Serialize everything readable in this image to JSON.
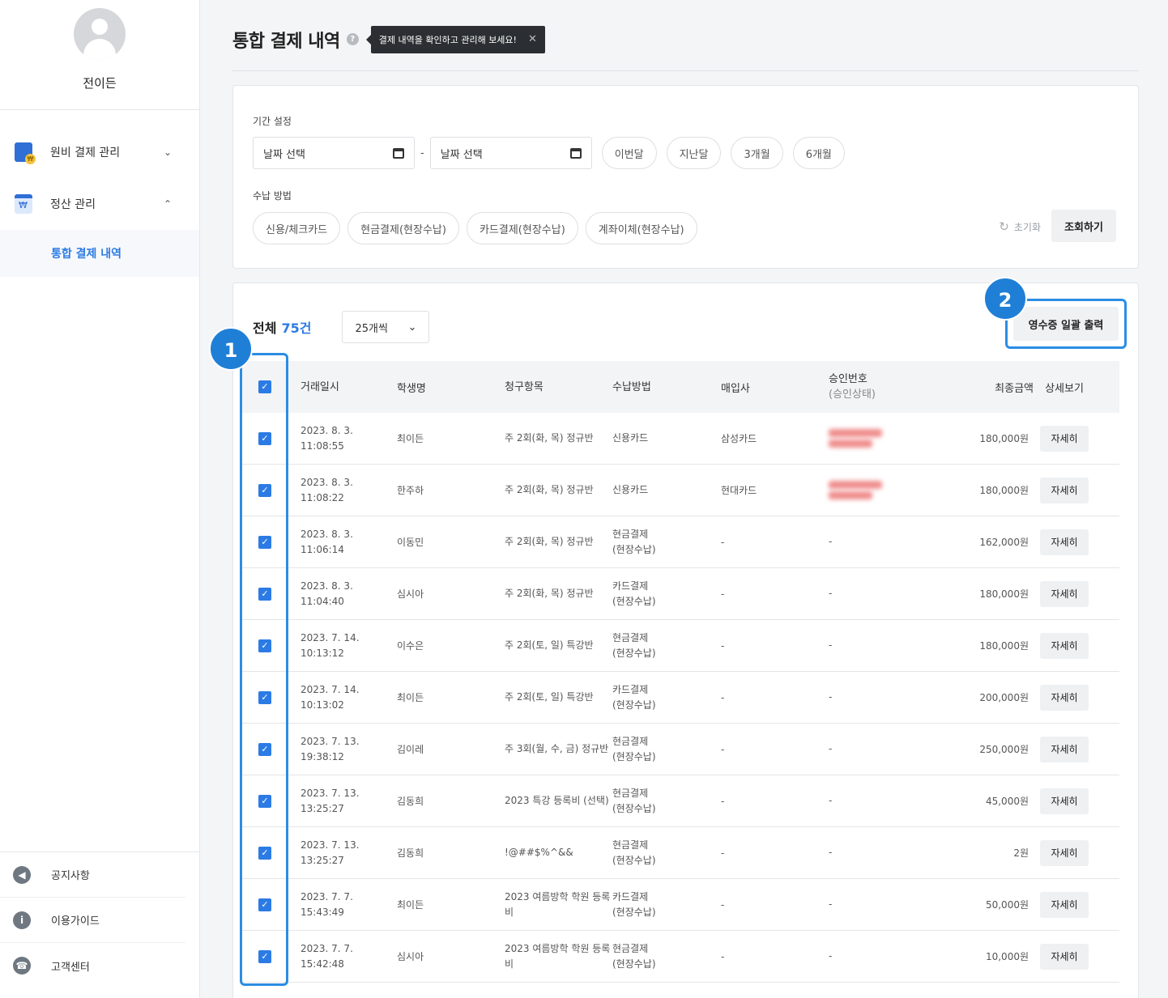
{
  "sidebar": {
    "profile_name": "전이든",
    "menu": [
      {
        "label": "원비 결제 관리",
        "icon": "tuition-icon",
        "expanded": false
      },
      {
        "label": "정산 관리",
        "icon": "settlement-icon",
        "expanded": true
      }
    ],
    "submenu_active": "통합 결제 내역",
    "bottom": [
      {
        "label": "공지사항",
        "icon": "megaphone-icon",
        "glyph": "◀"
      },
      {
        "label": "이용가이드",
        "icon": "info-icon",
        "glyph": "i"
      },
      {
        "label": "고객센터",
        "icon": "headset-icon",
        "glyph": "☎"
      }
    ]
  },
  "header": {
    "title": "통합 결제 내역",
    "help_glyph": "?",
    "tooltip": "결제 내역을 확인하고 관리해 보세요!",
    "tooltip_close": "✕"
  },
  "filter": {
    "period_label": "기간 설정",
    "date_start_placeholder": "날짜 선택",
    "date_end_placeholder": "날짜 선택",
    "date_separator": "-",
    "quick_ranges": [
      "이번달",
      "지난달",
      "3개월",
      "6개월"
    ],
    "method_label": "수납 방법",
    "methods": [
      "신용/체크카드",
      "현금결제(현장수납)",
      "카드결제(현장수납)",
      "계좌이체(현장수납)"
    ],
    "reset_label": "초기화",
    "search_label": "조회하기"
  },
  "list": {
    "total_label": "전체",
    "total_count": "75건",
    "per_page": "25개씩",
    "receipt_button": "영수증 일괄 출력",
    "badges": [
      "1",
      "2"
    ],
    "columns": {
      "date": "거래일시",
      "name": "학생명",
      "item": "청구항목",
      "method": "수납방법",
      "acquirer": "매입사",
      "approval": "승인번호",
      "approval_sub": "(승인상태)",
      "amount": "최종금액",
      "detail": "상세보기"
    },
    "detail_label": "자세히",
    "rows": [
      {
        "date": "2023. 8. 3.",
        "time": "11:08:55",
        "name": "최이든",
        "item": "주 2회(화, 목) 정규반",
        "method": "신용카드",
        "method2": "",
        "acquirer": "삼성카드",
        "approval": "",
        "amount": "180,000원",
        "redacted": true
      },
      {
        "date": "2023. 8. 3.",
        "time": "11:08:22",
        "name": "한주하",
        "item": "주 2회(화, 목) 정규반",
        "method": "신용카드",
        "method2": "",
        "acquirer": "현대카드",
        "approval": "",
        "amount": "180,000원",
        "redacted": true
      },
      {
        "date": "2023. 8. 3.",
        "time": "11:06:14",
        "name": "이동민",
        "item": "주 2회(화, 목) 정규반",
        "method": "현금결제",
        "method2": "(현장수납)",
        "acquirer": "-",
        "approval": "-",
        "amount": "162,000원",
        "redacted": false
      },
      {
        "date": "2023. 8. 3.",
        "time": "11:04:40",
        "name": "심시아",
        "item": "주 2회(화, 목) 정규반",
        "method": "카드결제",
        "method2": "(현장수납)",
        "acquirer": "-",
        "approval": "-",
        "amount": "180,000원",
        "redacted": false
      },
      {
        "date": "2023. 7. 14.",
        "time": "10:13:12",
        "name": "이수은",
        "item": "주 2회(토, 일) 특강반",
        "method": "현금결제",
        "method2": "(현장수납)",
        "acquirer": "-",
        "approval": "-",
        "amount": "180,000원",
        "redacted": false
      },
      {
        "date": "2023. 7. 14.",
        "time": "10:13:02",
        "name": "최이든",
        "item": "주 2회(토, 일) 특강반",
        "method": "카드결제",
        "method2": "(현장수납)",
        "acquirer": "-",
        "approval": "-",
        "amount": "200,000원",
        "redacted": false
      },
      {
        "date": "2023. 7. 13.",
        "time": "19:38:12",
        "name": "김이레",
        "item": "주 3회(월, 수, 금) 정규반",
        "method": "현금결제",
        "method2": "(현장수납)",
        "acquirer": "-",
        "approval": "-",
        "amount": "250,000원",
        "redacted": false
      },
      {
        "date": "2023. 7. 13.",
        "time": "13:25:27",
        "name": "김동희",
        "item": "2023 특강 등록비 (선택)",
        "method": "현금결제",
        "method2": "(현장수납)",
        "acquirer": "-",
        "approval": "-",
        "amount": "45,000원",
        "redacted": false
      },
      {
        "date": "2023. 7. 13.",
        "time": "13:25:27",
        "name": "김동희",
        "item": "!@##$%^&&",
        "method": "현금결제",
        "method2": "(현장수납)",
        "acquirer": "-",
        "approval": "-",
        "amount": "2원",
        "redacted": false
      },
      {
        "date": "2023. 7. 7.",
        "time": "15:43:49",
        "name": "최이든",
        "item": "2023 여름방학 학원 등록비",
        "method": "카드결제",
        "method2": "(현장수납)",
        "acquirer": "-",
        "approval": "-",
        "amount": "50,000원",
        "redacted": false
      },
      {
        "date": "2023. 7. 7.",
        "time": "15:42:48",
        "name": "심시아",
        "item": "2023 여름방학 학원 등록비",
        "method": "현금결제",
        "method2": "(현장수납)",
        "acquirer": "-",
        "approval": "-",
        "amount": "10,000원",
        "redacted": false
      }
    ]
  },
  "colors": {
    "accent": "#2c7be5",
    "highlight_frame": "#2b8de3",
    "badge": "#1f7fd6"
  }
}
